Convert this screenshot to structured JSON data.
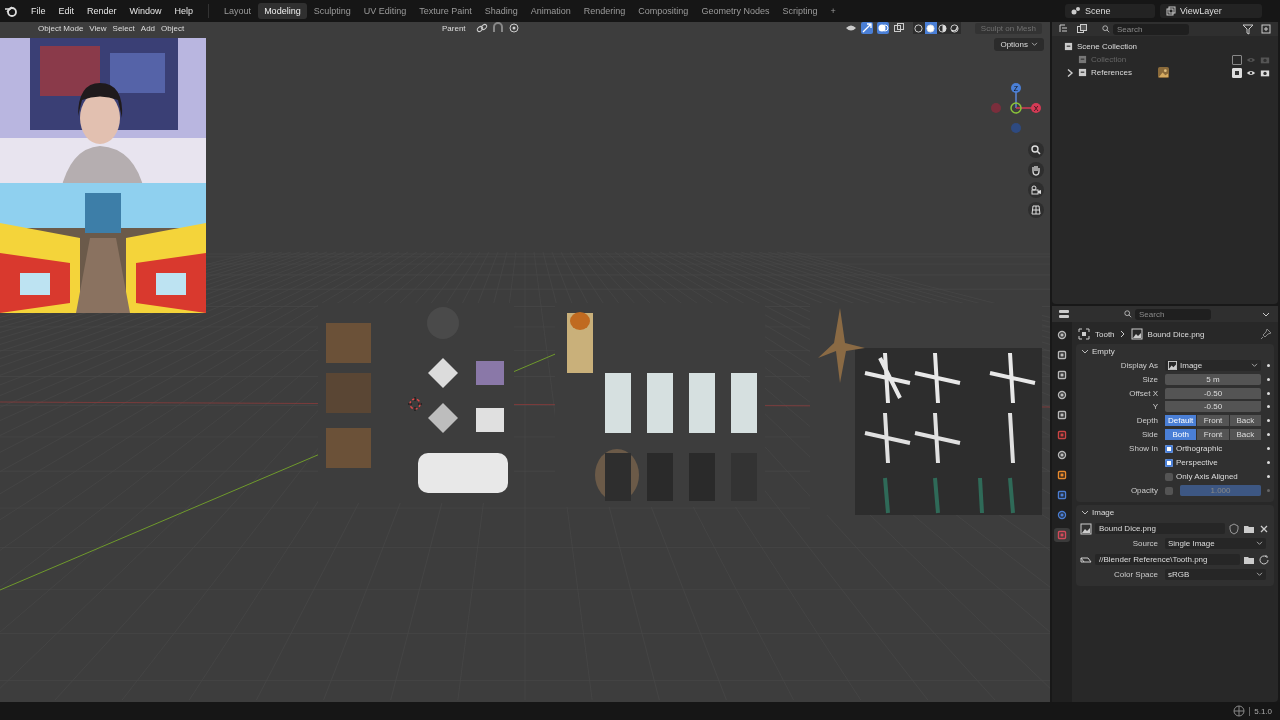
{
  "topbar": {
    "menus": [
      "File",
      "Edit",
      "Render",
      "Window",
      "Help"
    ],
    "workspaces": [
      {
        "label": "Layout",
        "selected": false
      },
      {
        "label": "Modeling",
        "selected": true
      },
      {
        "label": "Sculpting",
        "selected": false
      },
      {
        "label": "UV Editing",
        "selected": false
      },
      {
        "label": "Texture Paint",
        "selected": false
      },
      {
        "label": "Shading",
        "selected": false
      },
      {
        "label": "Animation",
        "selected": false
      },
      {
        "label": "Rendering",
        "selected": false
      },
      {
        "label": "Compositing",
        "selected": false
      },
      {
        "label": "Geometry Nodes",
        "selected": false
      },
      {
        "label": "Scripting",
        "selected": false
      }
    ],
    "add_tab": "+",
    "scene": "Scene",
    "view_layer": "ViewLayer"
  },
  "viewport": {
    "mode": "Object Mode",
    "menus": [
      "View",
      "Select",
      "Add",
      "Object"
    ],
    "pivot": "Parent",
    "shading": [
      {
        "selected": false
      },
      {
        "selected": true
      },
      {
        "selected": false
      },
      {
        "selected": false
      }
    ],
    "sculpt_button": {
      "label": "Sculpt on Mesh",
      "disabled": true
    },
    "options": "Options",
    "gizmo": {
      "z": "Z",
      "x": "X"
    }
  },
  "outliner": {
    "search": {
      "placeholder": "Search"
    },
    "tree": [
      {
        "label": "Scene Collection",
        "children": [
          {
            "label": "Collection",
            "included": false
          },
          {
            "label": "References",
            "included": true,
            "expanded": false
          }
        ]
      }
    ]
  },
  "properties": {
    "search": {
      "placeholder": "Search"
    },
    "tabs": [
      {
        "selected": false
      },
      {
        "selected": false
      },
      {
        "selected": false
      },
      {
        "selected": false
      },
      {
        "selected": false
      },
      {
        "selected": false
      },
      {
        "selected": false
      },
      {
        "selected": false
      },
      {
        "selected": false
      },
      {
        "selected": false
      },
      {
        "selected": true
      }
    ],
    "breadcrumb": [
      "Tooth",
      "Bound Dice.png"
    ],
    "empty_panel": {
      "title": "Empty",
      "expanded": true,
      "display_as": {
        "label": "Display As",
        "value": "Image"
      },
      "size": {
        "label": "Size",
        "value": "5 m"
      },
      "offset_x": {
        "label": "Offset X",
        "value": "-0.50"
      },
      "offset_y": {
        "label": "Y",
        "value": "-0.50"
      },
      "depth": {
        "label": "Depth",
        "options": [
          {
            "label": "Default",
            "selected": true
          },
          {
            "label": "Front",
            "selected": false
          },
          {
            "label": "Back",
            "selected": false
          }
        ]
      },
      "side": {
        "label": "Side",
        "options": [
          {
            "label": "Both",
            "selected": true
          },
          {
            "label": "Front",
            "selected": false
          },
          {
            "label": "Back",
            "selected": false
          }
        ]
      },
      "show_in": {
        "label": "Show In",
        "options": [
          {
            "label": "Orthographic",
            "checked": true
          },
          {
            "label": "Perspective",
            "checked": true
          },
          {
            "label": "Only Axis Aligned",
            "checked": false
          }
        ]
      },
      "opacity": {
        "label": "Opacity",
        "checked": false,
        "value": "1.000",
        "level": 1
      }
    },
    "image_panel": {
      "title": "Image",
      "expanded": true,
      "image": "Bound Dice.png",
      "source": {
        "label": "Source",
        "value": "Single Image"
      },
      "filepath": "//Blender Reference\\Tooth.png",
      "color_space": {
        "label": "Color Space",
        "value": "sRGB"
      }
    }
  },
  "status_bar": {
    "version": "5.1.0"
  }
}
